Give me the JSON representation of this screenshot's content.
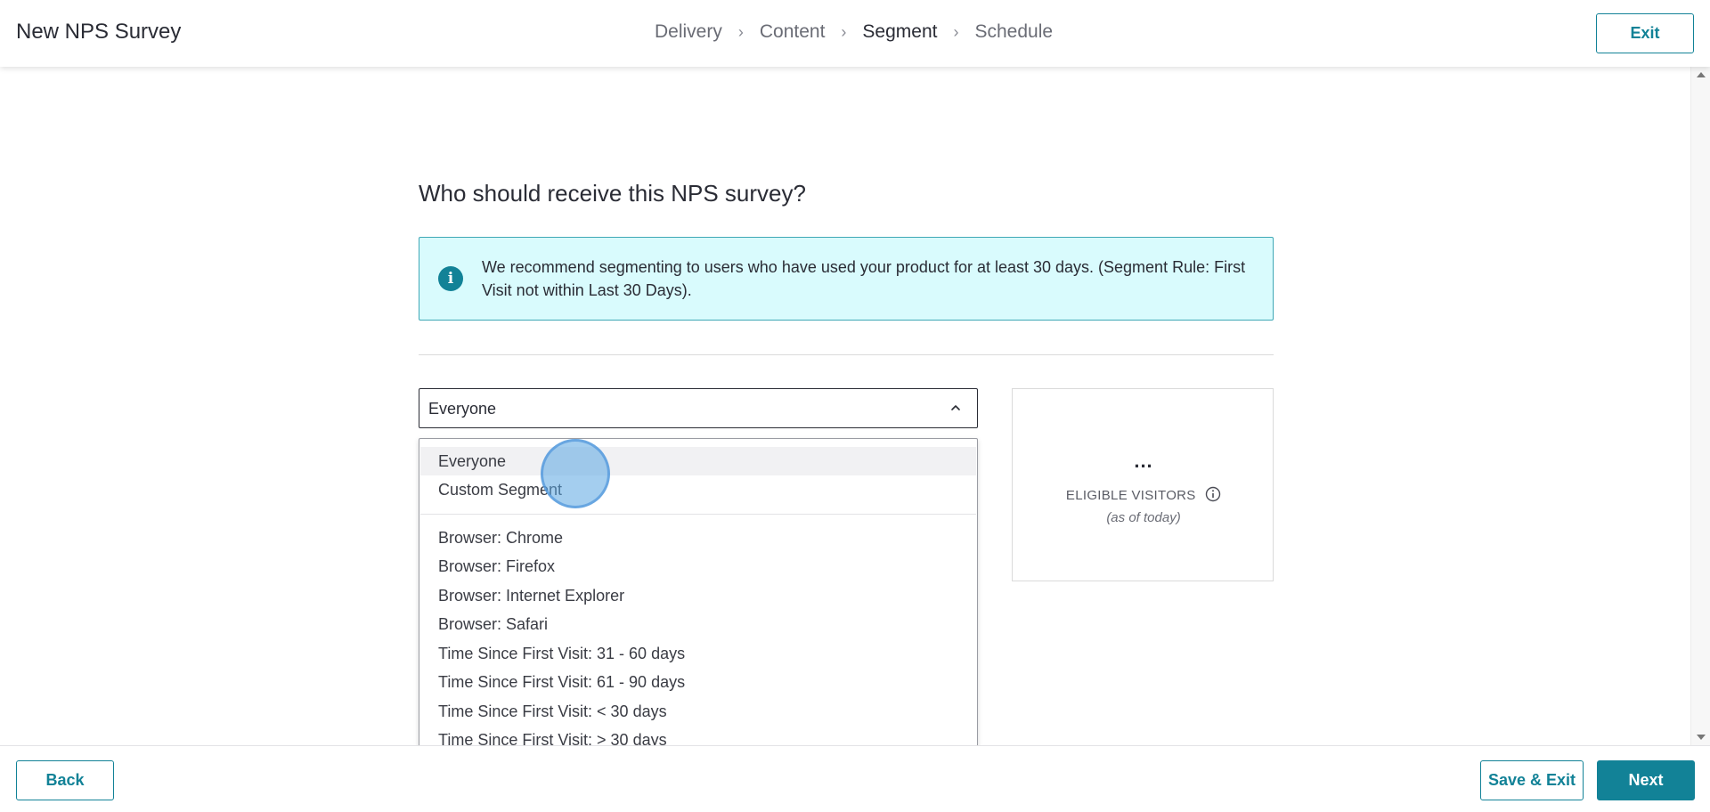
{
  "header": {
    "title": "New NPS Survey",
    "steps": [
      {
        "label": "Delivery",
        "active": false
      },
      {
        "label": "Content",
        "active": false
      },
      {
        "label": "Segment",
        "active": true
      },
      {
        "label": "Schedule",
        "active": false
      }
    ],
    "exit_label": "Exit"
  },
  "main": {
    "question": "Who should receive this NPS survey?",
    "info_text": "We recommend segmenting to users who have used your product for at least 30 days. (Segment Rule: First Visit not within Last 30 Days).",
    "segment_select": {
      "value": "Everyone",
      "options_group_1": [
        "Everyone",
        "Custom Segment"
      ],
      "options_group_2": [
        "Browser: Chrome",
        "Browser: Firefox",
        "Browser: Internet Explorer",
        "Browser: Safari",
        "Time Since First Visit: 31 - 60 days",
        "Time Since First Visit: 61 - 90 days",
        "Time Since First Visit: < 30 days",
        "Time Since First Visit: > 30 days"
      ],
      "hovered_option": "Everyone"
    },
    "visitors": {
      "count": "...",
      "label": "ELIGIBLE VISITORS",
      "sublabel": "(as of today)"
    }
  },
  "footer": {
    "back_label": "Back",
    "save_exit_label": "Save & Exit",
    "next_label": "Next"
  },
  "colors": {
    "accent": "#128297",
    "info_bg": "#d9fbfd",
    "info_border": "#3fa8b6"
  }
}
